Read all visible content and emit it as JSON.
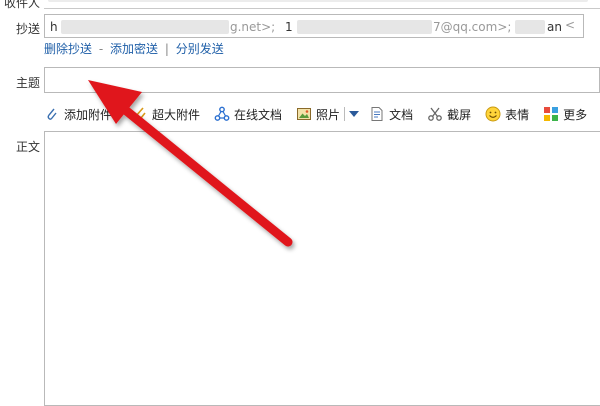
{
  "labels": {
    "to": "收件人",
    "cc": "抄送",
    "subject": "主题",
    "body": "正文"
  },
  "cc_recipients": {
    "r1_start": "h",
    "r1_end": "g.net>;",
    "r2_start": "1",
    "r2_end": "7@qq.com>;",
    "r3_end": "an"
  },
  "cc_links": {
    "delete_cc": "删除抄送",
    "add_bcc": "添加密送",
    "separate_send": "分别发送",
    "dash": "-",
    "bar": "|"
  },
  "subject": {
    "value": ""
  },
  "toolbar": {
    "attach": "添加附件",
    "large_attach": "超大附件",
    "online_doc": "在线文档",
    "photo": "照片",
    "doc": "文档",
    "screenshot": "截屏",
    "emoji": "表情",
    "more": "更多"
  },
  "colors": {
    "arrow": "#e0191b",
    "link": "#1f5fa8",
    "border": "#b9b9b9"
  }
}
